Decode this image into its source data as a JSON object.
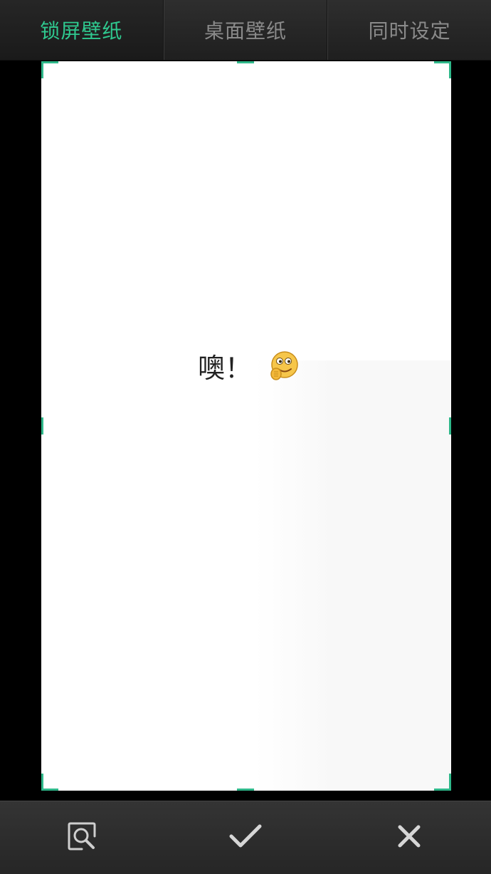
{
  "tabs": [
    {
      "label": "锁屏壁纸",
      "active": true
    },
    {
      "label": "桌面壁纸",
      "active": false
    },
    {
      "label": "同时设定",
      "active": false
    }
  ],
  "preview": {
    "caption": "噢！",
    "emoji_icon": "thinking-face-icon"
  },
  "toolbar": {
    "preview_icon": "preview-icon",
    "confirm_icon": "checkmark-icon",
    "cancel_icon": "close-icon"
  },
  "colors": {
    "accent": "#2fc98f",
    "inactive_tab": "#8a8a8a",
    "handle": "#2fb88a"
  }
}
